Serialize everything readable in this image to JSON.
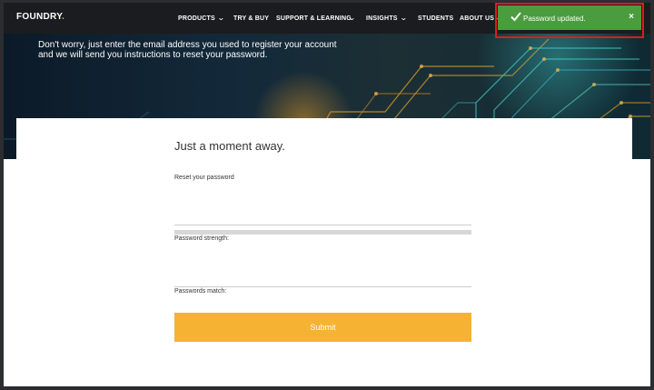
{
  "nav": {
    "logo": "FOUNDRY",
    "items": [
      "PRODUCTS",
      "TRY & BUY",
      "SUPPORT & LEARNING",
      "INSIGHTS",
      "STUDENTS",
      "ABOUT US"
    ]
  },
  "hero": {
    "intro": "Don't worry, just enter the email address you used to register your account and we will send you instructions to reset your password."
  },
  "form": {
    "heading": "Just a moment away.",
    "reset_label": "Reset your password",
    "strength_label": "Password strength:",
    "match_label": "Passwords match:",
    "submit_label": "Submit"
  },
  "toast": {
    "message": "Password updated.",
    "close": "×",
    "color": "#4a9c3e"
  },
  "colors": {
    "accent": "#f6b233",
    "highlight": "#e3191c"
  }
}
